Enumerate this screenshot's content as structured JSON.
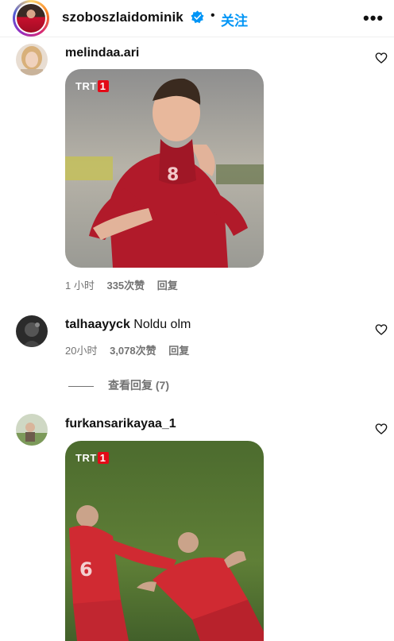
{
  "header": {
    "username": "szoboszlaidominik",
    "separator": "•",
    "follow_label": "关注",
    "more_label": "•••"
  },
  "comments": [
    {
      "username": "melindaa.ari",
      "text": "",
      "media_badge": "TRT",
      "media_badge_num": "1",
      "time": "1 小时",
      "likes": "335次赞",
      "reply_label": "回复"
    },
    {
      "username": "talhaayyck",
      "text": "Noldu olm",
      "time": "20小时",
      "likes": "3,078次赞",
      "reply_label": "回复",
      "view_replies": "查看回复 (7)"
    },
    {
      "username": "furkansarikayaa_1",
      "text": "",
      "media_badge": "TRT",
      "media_badge_num": "1"
    }
  ],
  "colors": {
    "accent": "#0095f6",
    "muted": "#737373"
  },
  "icons": [
    "verified-badge-icon",
    "more-options-icon",
    "heart-icon"
  ]
}
